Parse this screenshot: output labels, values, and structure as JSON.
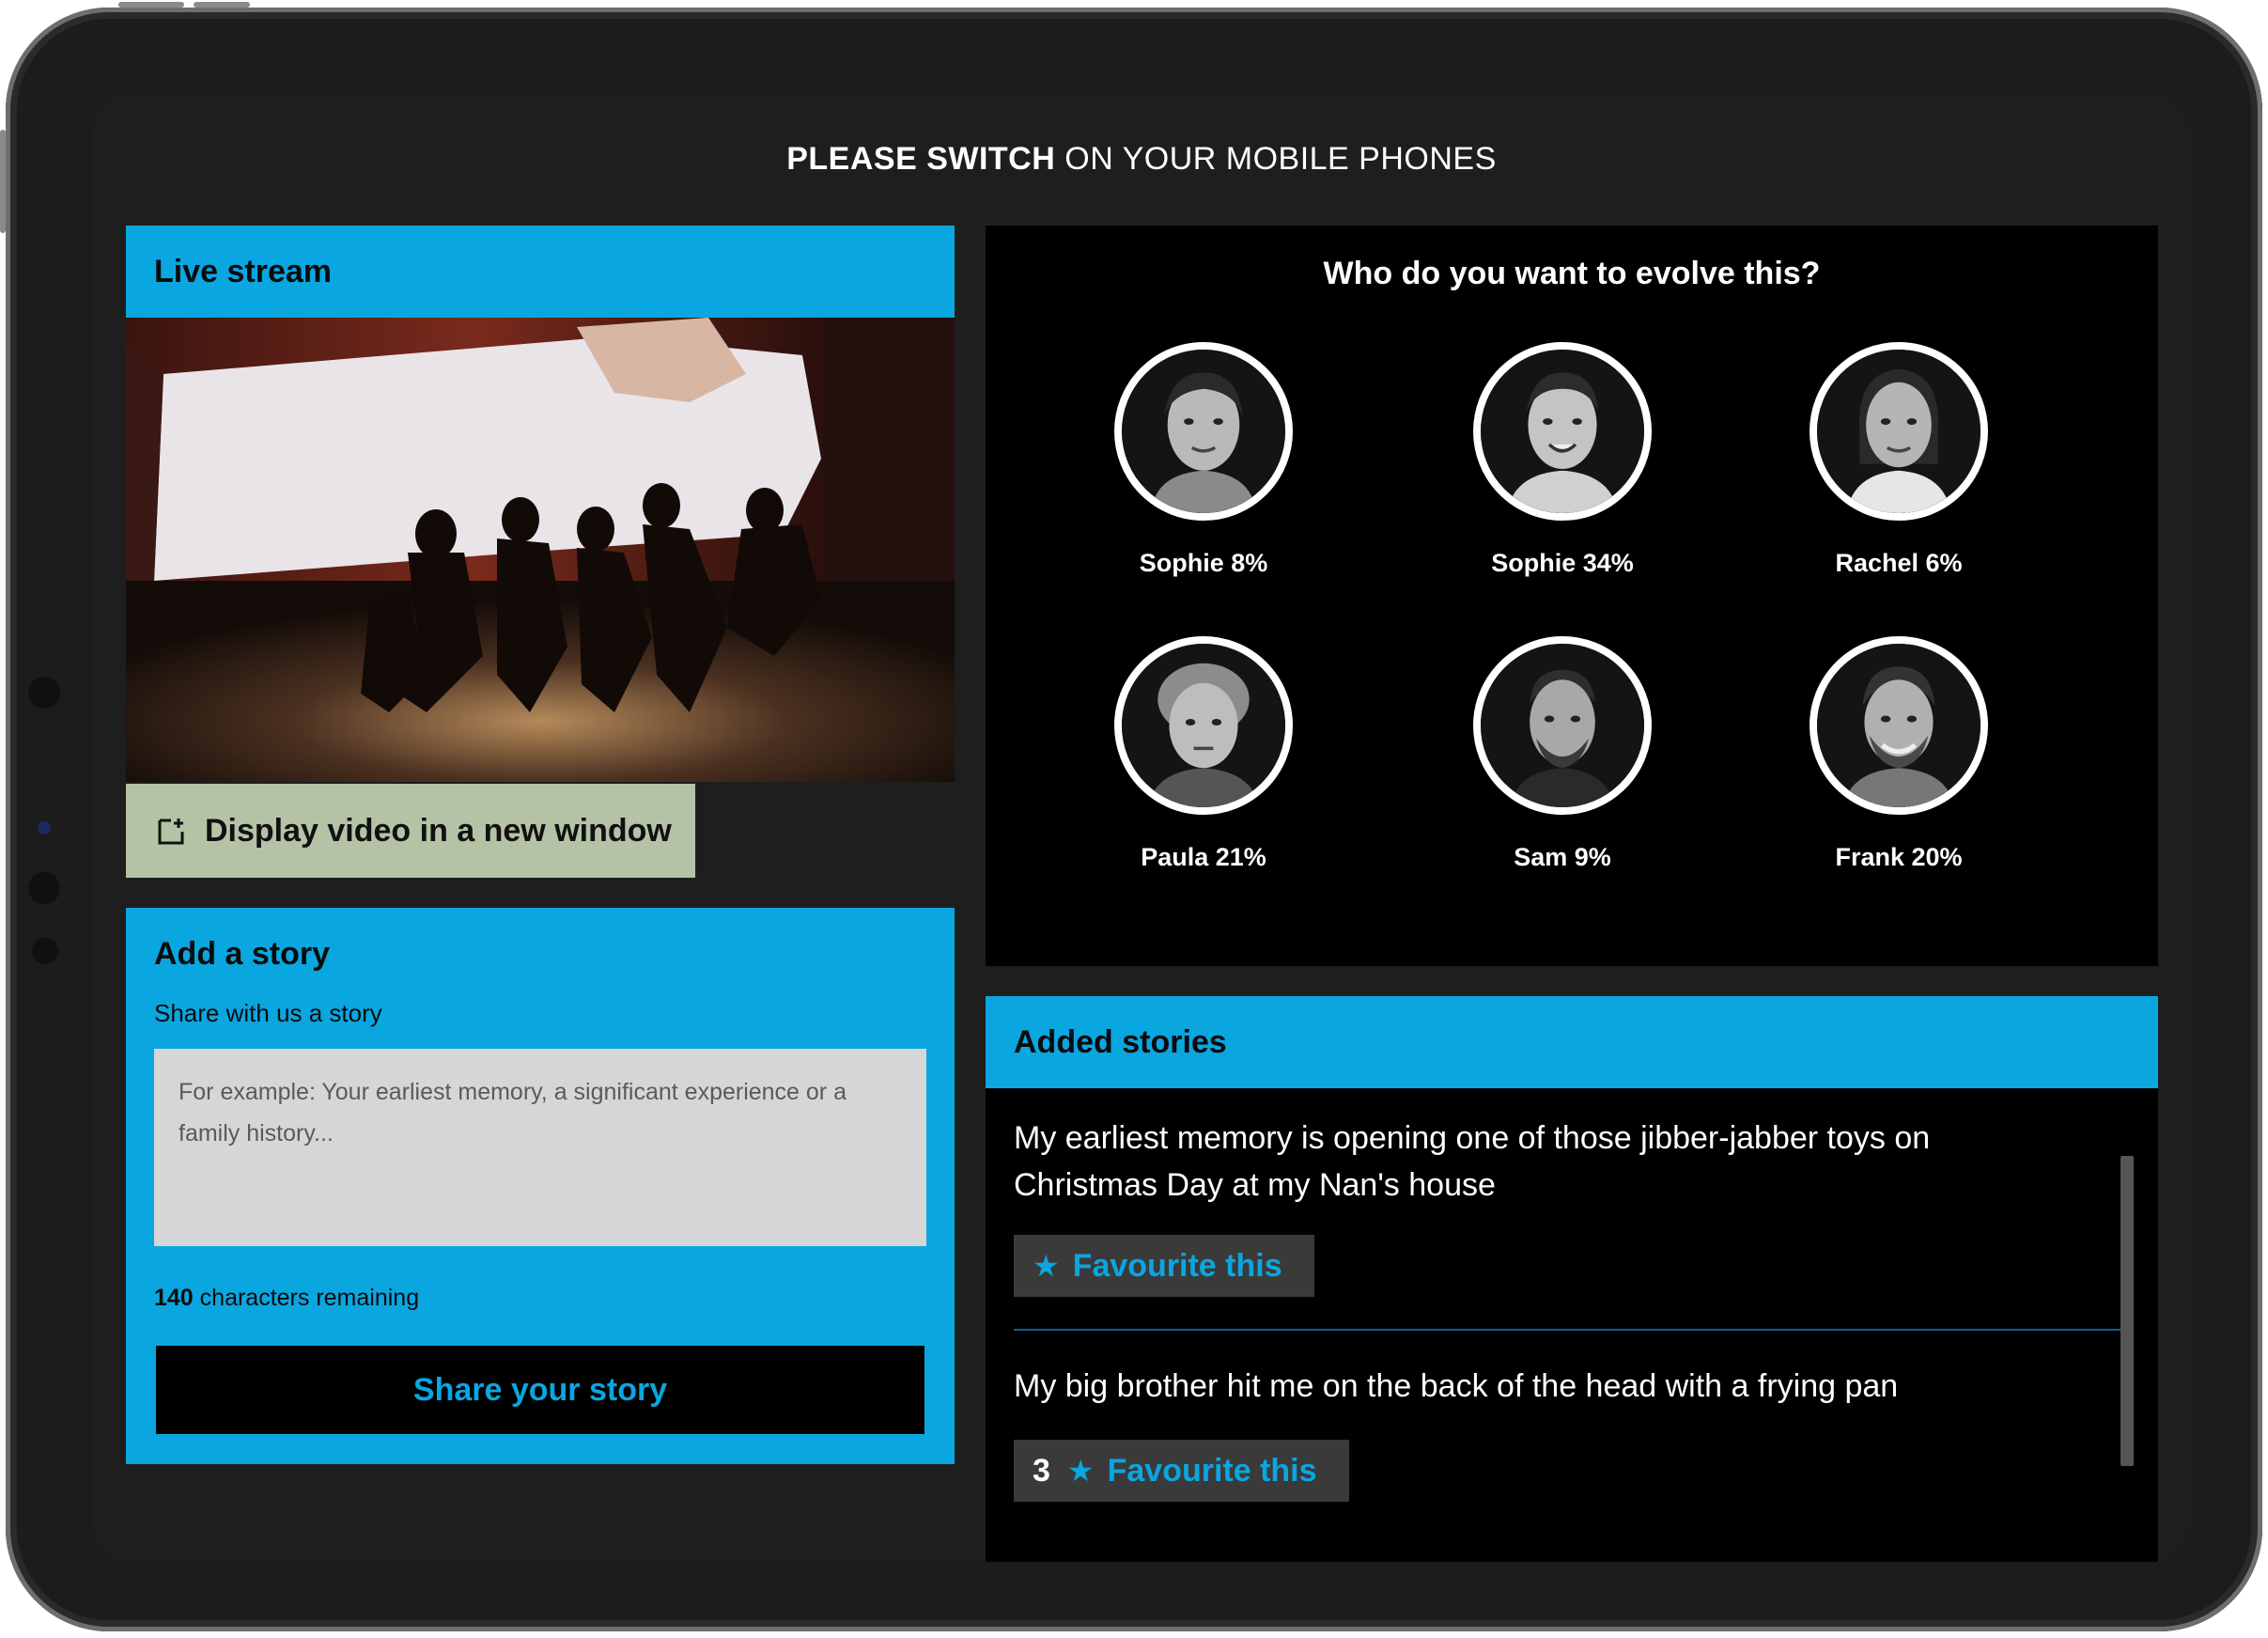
{
  "banner": {
    "bold": "PLEASE SWITCH",
    "rest": " ON YOUR MOBILE PHONES"
  },
  "live_stream": {
    "title": "Live stream",
    "display_button_label": "Display video in a new window",
    "display_icon": "open-new-window-icon"
  },
  "add_story": {
    "title": "Add a story",
    "subtitle": "Share with us a story",
    "placeholder": "For example: Your earliest memory, a significant experience or a family history...",
    "chars_count": "140",
    "chars_text": " characters remaining",
    "submit_label": "Share your story"
  },
  "vote": {
    "question": "Who do you want to evolve this?",
    "people": [
      {
        "label": "Sophie 8%"
      },
      {
        "label": "Sophie 34%"
      },
      {
        "label": "Rachel 6%"
      },
      {
        "label": "Paula 21%"
      },
      {
        "label": "Sam 9%"
      },
      {
        "label": "Frank 20%"
      }
    ]
  },
  "added_stories": {
    "title": "Added stories",
    "items": [
      {
        "text": "My earliest memory is opening one of those jibber-jabber toys on Christmas Day at my Nan's house",
        "count": "",
        "fav_label": "Favourite this"
      },
      {
        "text": "My big brother hit me on the back of the head with a frying pan",
        "count": "3",
        "fav_label": "Favourite this"
      }
    ]
  },
  "colors": {
    "accent": "#0aa6e0",
    "display_button": "#b4c3a5",
    "panel_black": "#000000",
    "screen_bg": "#1e1e1e"
  }
}
